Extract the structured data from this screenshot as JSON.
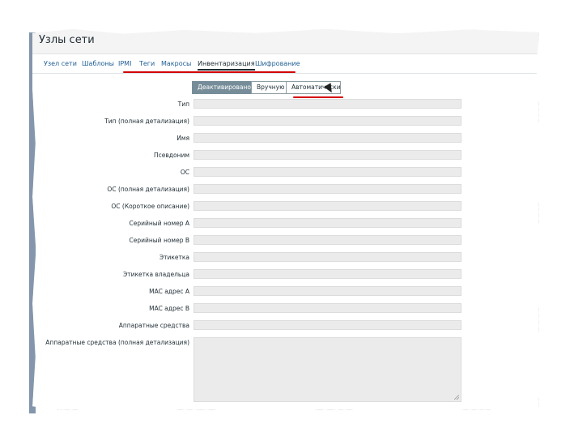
{
  "page": {
    "title": "Узлы сети"
  },
  "tabs": [
    {
      "label": "Узел сети"
    },
    {
      "label": "Шаблоны"
    },
    {
      "label": "IPMI"
    },
    {
      "label": "Теги"
    },
    {
      "label": "Макросы"
    },
    {
      "label": "Инвентаризация"
    },
    {
      "label": "Шифрование"
    }
  ],
  "inventory_mode": {
    "options": [
      "Деактивировано",
      "Вручную",
      "Автоматически"
    ],
    "selected": "Деактивировано"
  },
  "fields": [
    {
      "label": "Тип"
    },
    {
      "label": "Тип (полная детализация)"
    },
    {
      "label": "Имя"
    },
    {
      "label": "Псевдоним"
    },
    {
      "label": "ОС"
    },
    {
      "label": "ОС (полная детализация)"
    },
    {
      "label": "ОС (Короткое описание)"
    },
    {
      "label": "Серийный номер A"
    },
    {
      "label": "Серийный номер B"
    },
    {
      "label": "Этикетка"
    },
    {
      "label": "Этикетка владельца"
    },
    {
      "label": "MAC адрес A"
    },
    {
      "label": "MAC адрес B"
    },
    {
      "label": "Аппаратные средства"
    }
  ],
  "textarea_field": {
    "label": "Аппаратные средства (полная детализация)"
  },
  "colors": {
    "accent": "#768d99",
    "link": "#1f5e93",
    "annotation": "#d40000"
  }
}
